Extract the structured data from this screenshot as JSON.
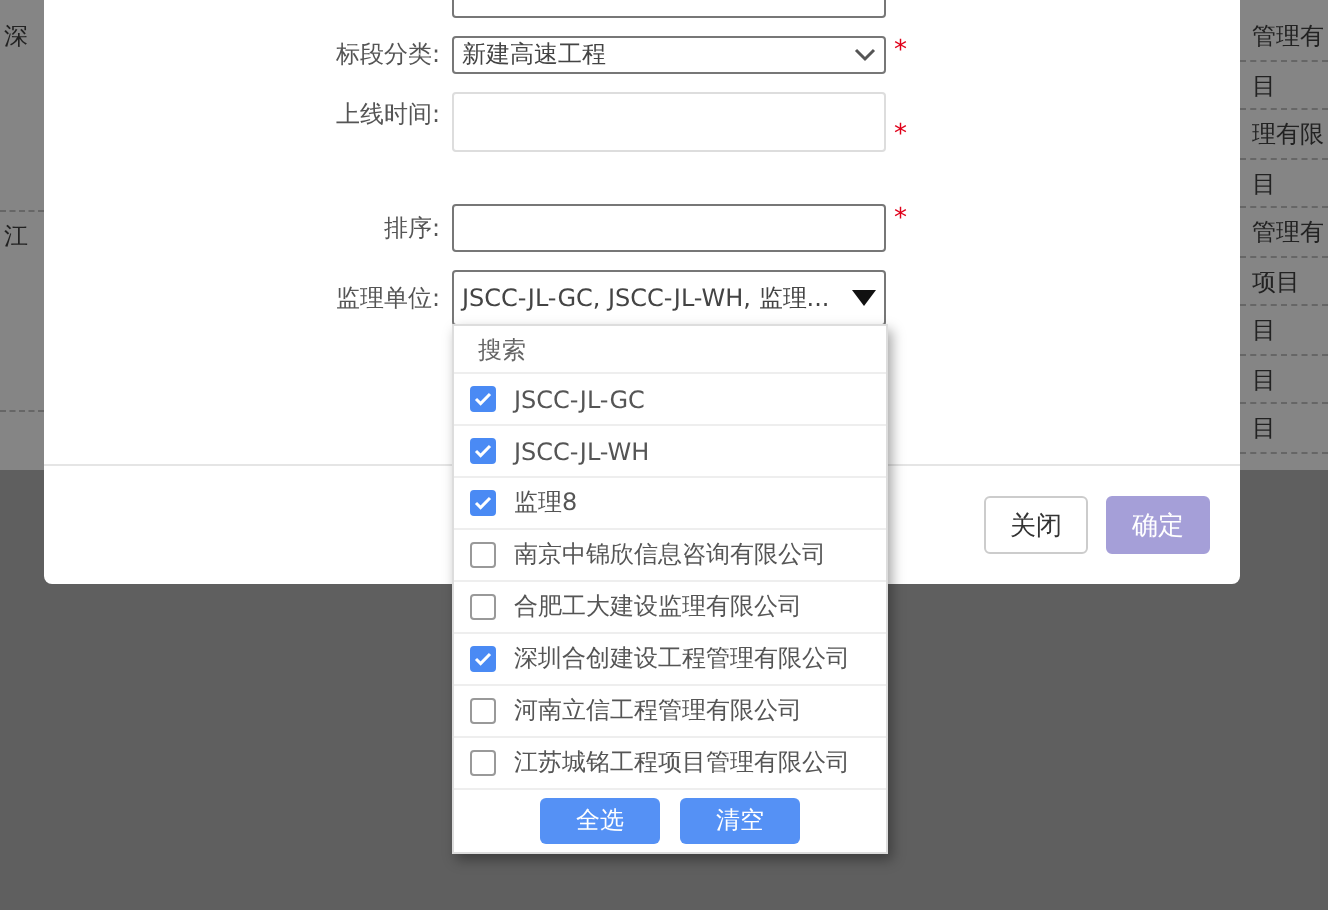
{
  "background_table": {
    "left_cells": [
      "深",
      "江"
    ],
    "right_cells": [
      "管理有",
      "目",
      "理有限",
      "目",
      "管理有",
      "项目",
      "目",
      "目",
      "目"
    ]
  },
  "dialog": {
    "required_mark": "*",
    "fields": [
      {
        "label": "标段分类:",
        "kind": "select",
        "value": "新建高速工程",
        "required": true
      },
      {
        "label": "上线时间:",
        "kind": "textarea",
        "required": true
      },
      {
        "label": "排序:",
        "kind": "input",
        "required": true
      },
      {
        "label": "监理单位:",
        "kind": "multiselect",
        "value": "JSCC-JL-GC, JSCC-JL-WH, 监理...",
        "required": false,
        "expanded": true
      }
    ],
    "dropdown": {
      "search_placeholder": "搜索",
      "options": [
        {
          "label": "JSCC-JL-GC",
          "checked": true
        },
        {
          "label": "JSCC-JL-WH",
          "checked": true
        },
        {
          "label": "监理8",
          "checked": true
        },
        {
          "label": "南京中锦欣信息咨询有限公司",
          "checked": false
        },
        {
          "label": "合肥工大建设监理有限公司",
          "checked": false
        },
        {
          "label": "深圳合创建设工程管理有限公司",
          "checked": true
        },
        {
          "label": "河南立信工程管理有限公司",
          "checked": false
        },
        {
          "label": "江苏城铭工程项目管理有限公司",
          "checked": false
        }
      ],
      "buttons": [
        "全选",
        "清空"
      ]
    },
    "footer_buttons": [
      {
        "label": "关闭",
        "kind": "default"
      },
      {
        "label": "确定",
        "kind": "primary"
      }
    ]
  }
}
